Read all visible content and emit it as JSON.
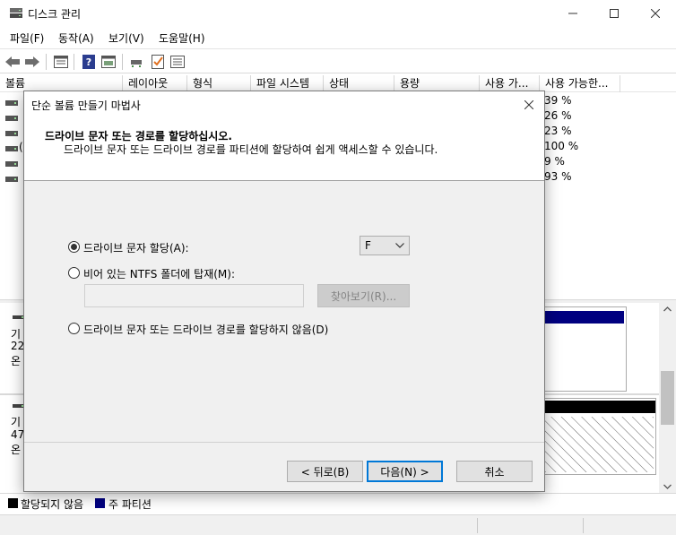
{
  "window": {
    "title": "디스크 관리"
  },
  "menu": [
    "파일(F)",
    "동작(A)",
    "보기(V)",
    "도움말(H)"
  ],
  "toolbar": {
    "icons": [
      "back-arrow-icon",
      "forward-arrow-icon",
      "properties-icon",
      "help-icon",
      "console-icon",
      "connect-icon",
      "check-icon",
      "settings-icon"
    ]
  },
  "volumes": {
    "columns": [
      "볼륨",
      "레이아웃",
      "형식",
      "파일 시스템",
      "상태",
      "용량",
      "사용 가...",
      "사용 가능한..."
    ],
    "percent_free": [
      "39 %",
      "26 %",
      "23 %",
      "100 %",
      "9 %",
      "93 %"
    ],
    "row_fragments": [
      "(",
      "",
      ""
    ]
  },
  "disks": [
    {
      "line1": "기",
      "line2": "22",
      "line3": "온"
    },
    {
      "line1": "기",
      "line2": "47",
      "line3": "온"
    }
  ],
  "legend": {
    "unallocated": "할당되지 않음",
    "primary": "주 파티션"
  },
  "colors": {
    "unallocated": "#000000",
    "primary": "#000080",
    "accent": "#0078d7"
  },
  "wizard": {
    "title": "단순 볼륨 만들기 마법사",
    "heading": "드라이브 문자 또는 경로를 할당하십시오.",
    "subheading": "드라이브 문자 또는 드라이브 경로를 파티션에 할당하여 쉽게 액세스할 수 있습니다.",
    "options": {
      "assign_letter": "드라이브 문자 할당(A):",
      "mount_folder": "비어 있는 NTFS 폴더에 탑재(M):",
      "no_assign": "드라이브 문자 또는 드라이브 경로를 할당하지 않음(D)"
    },
    "selected_option": "assign_letter",
    "drive_letter": "F",
    "folder_path": "",
    "browse_label": "찾아보기(R)...",
    "back_label": "< 뒤로(B)",
    "next_label": "다음(N) >",
    "cancel_label": "취소"
  }
}
